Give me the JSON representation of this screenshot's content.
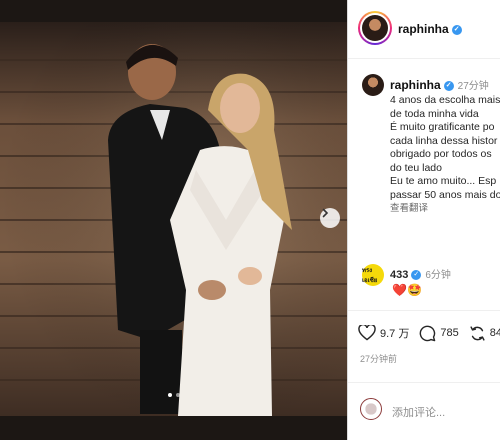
{
  "header": {
    "username": "raphinha"
  },
  "post": {
    "username": "raphinha",
    "time_ago": "27分钟",
    "caption_lines": [
      "4 anos da escolha mais",
      "de toda minha vida",
      "É muito gratificante po",
      "cada linha dessa histor",
      "obrigado por todos os",
      "do teu lado",
      "Eu te amo muito... Esp",
      "passar 50 anos mais do"
    ],
    "translate_label": "查看翻译",
    "photo_dots": 2,
    "photo_active_index": 0
  },
  "comment": {
    "avatar_text": "ทรงเอเซีย",
    "username": "433",
    "time_ago": "6分钟",
    "text": "❤️🤩"
  },
  "actions": {
    "likes": "9.7 万",
    "comments": "785",
    "shares": "84"
  },
  "posted_time": "27分钟前",
  "add_comment_placeholder": "添加评论...",
  "icons": {
    "verified": "verified-badge-icon",
    "like": "heart-icon",
    "comment": "comment-bubble-icon",
    "share": "share-repost-icon",
    "next": "chevron-right-icon"
  },
  "colors": {
    "accent": "#3897f0",
    "panel_bg": "#ffffff",
    "photo_bg": "#1a1614"
  }
}
